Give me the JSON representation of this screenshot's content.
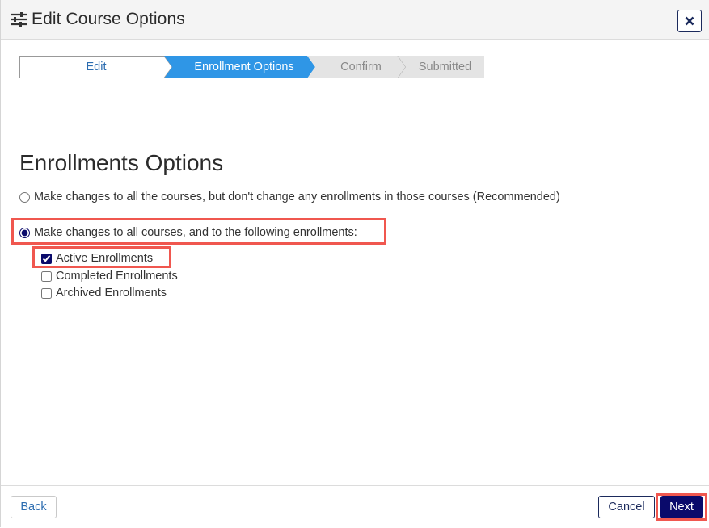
{
  "dialog": {
    "title": "Edit Course Options",
    "title_icon": "sliders-icon",
    "close_icon": "close-icon"
  },
  "wizard": {
    "steps": [
      {
        "label": "Edit",
        "state": "completed"
      },
      {
        "label": "Enrollment Options",
        "state": "active"
      },
      {
        "label": "Confirm",
        "state": "pending"
      },
      {
        "label": "Submitted",
        "state": "pending"
      }
    ]
  },
  "section": {
    "title": "Enrollments Options",
    "radio_options": [
      {
        "label": "Make changes to all the courses, but don't change any enrollments in those courses (Recommended)",
        "checked": false
      },
      {
        "label": "Make changes to all courses, and to the following enrollments:",
        "checked": true
      }
    ],
    "checkbox_options": [
      {
        "label": "Active Enrollments",
        "checked": true
      },
      {
        "label": "Completed Enrollments",
        "checked": false
      },
      {
        "label": "Archived Enrollments",
        "checked": false
      }
    ]
  },
  "footer": {
    "back_label": "Back",
    "cancel_label": "Cancel",
    "next_label": "Next"
  },
  "colors": {
    "active_step": "#2f96e6",
    "pending_step": "#e4e4e4",
    "primary": "#0a0a6b",
    "highlight": "#f0574f"
  }
}
